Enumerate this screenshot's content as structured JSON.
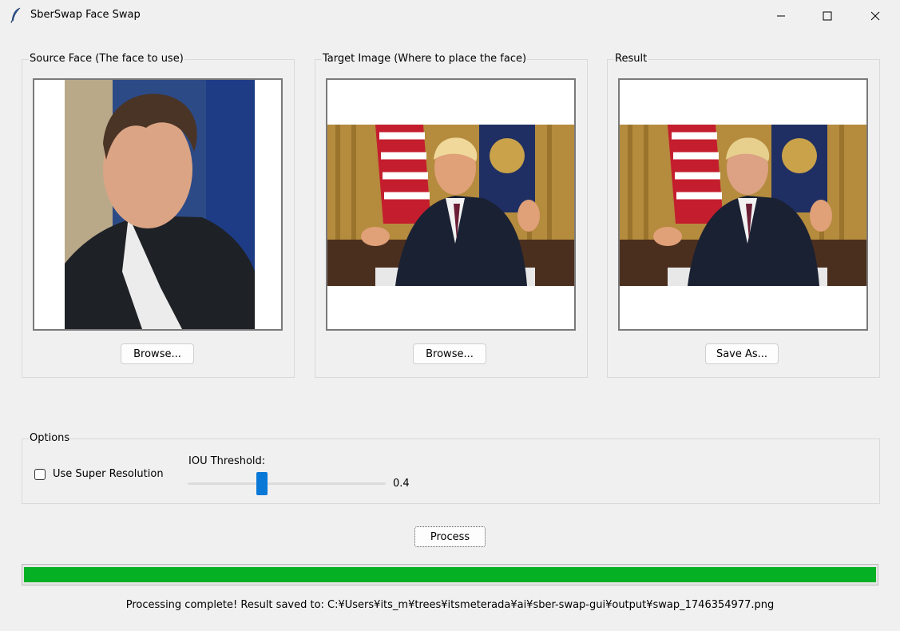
{
  "window": {
    "title": "SberSwap Face Swap"
  },
  "panels": {
    "source": {
      "label": "Source Face (The face to use)",
      "button": "Browse..."
    },
    "target": {
      "label": "Target Image (Where to place the face)",
      "button": "Browse..."
    },
    "result": {
      "label": "Result",
      "button": "Save As..."
    }
  },
  "options": {
    "label": "Options",
    "super_resolution": {
      "label": "Use Super Resolution",
      "checked": false
    },
    "iou_threshold": {
      "label": "IOU Threshold:",
      "value": "0.4",
      "fraction": 0.4
    }
  },
  "process_button": "Process",
  "progress": {
    "value_percent": 100,
    "color": "#06b025"
  },
  "status": "Processing complete! Result saved to: C:¥Users¥its_m¥trees¥itsmeterada¥ai¥sber-swap-gui¥output¥swap_1746354977.png",
  "colors": {
    "accent": "#0a78d7",
    "progress": "#06b025"
  }
}
